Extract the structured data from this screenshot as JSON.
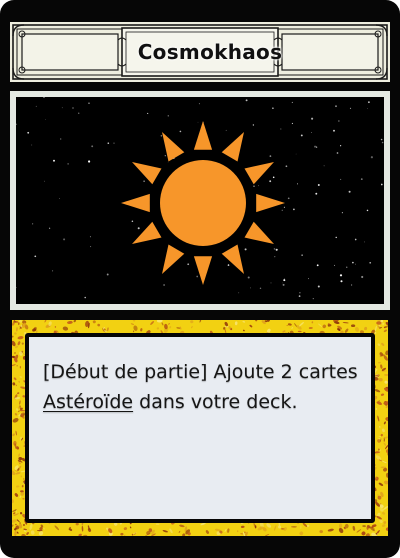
{
  "card": {
    "title": "Cosmokhaos",
    "art_icon": "sun-icon",
    "effect": {
      "prefix": "[Début de partie] Ajoute 2 cartes ",
      "keyword": "Astéroïde",
      "suffix": " dans votre deck."
    }
  },
  "colors": {
    "card_border": "#060606",
    "title_banner": "#eeeedf",
    "art_frame": "#e4e9e2",
    "space_background": "#000000",
    "sun": "#f7962a",
    "text_frame_gold": "#f2d112",
    "text_box": "#e8ecf2"
  }
}
